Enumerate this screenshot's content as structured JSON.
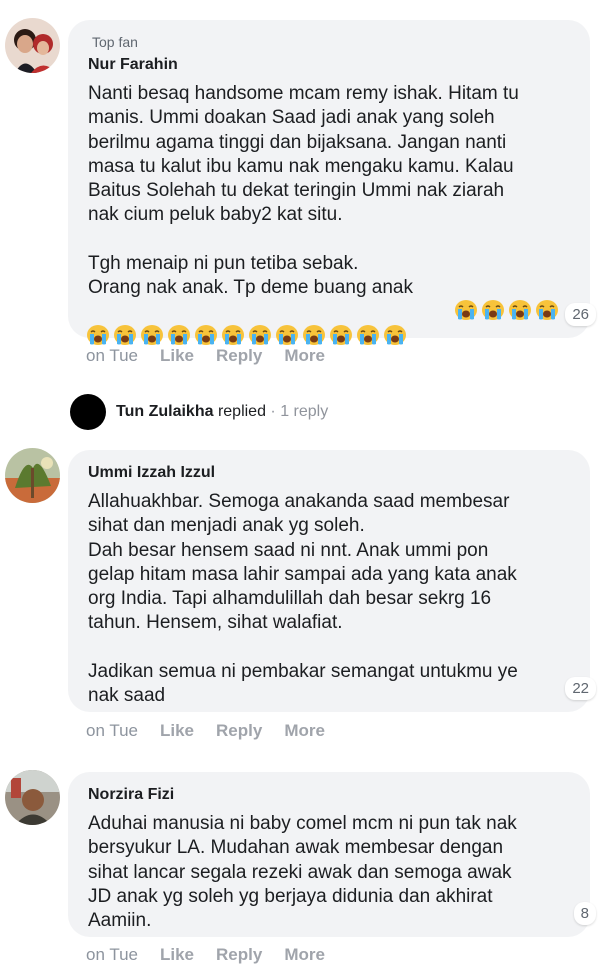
{
  "comments": [
    {
      "badge": "Top fan",
      "author": "Nur Farahin",
      "body": "Nanti besaq handsome mcam remy ishak. Hitam tu\nmanis. Ummi doakan Saad jadi anak yang soleh\nberilmu agama tinggi dan bijaksana. Jangan nanti\nmasa tu kalut ibu kamu nak mengaku kamu. Kalau\nBaitus Solehah tu dekat teringin Ummi nak ziarah\nnak cium peluk baby2 kat situ.\n\nTgh menaip ni pun tetiba sebak.\nOrang nak anak. Tp deme buang anak",
      "emoji_name": "loudly-crying-face-icon",
      "emoji_count_line1": 4,
      "emoji_count_line2": 12,
      "reaction_count": "26",
      "time": "on Tue",
      "like": "Like",
      "reply": "Reply",
      "more": "More"
    },
    {
      "author": "Ummi Izzah Izzul",
      "body": "Allahuakhbar. Semoga anakanda saad membesar\nsihat dan menjadi anak yg soleh.\nDah besar hensem saad ni nnt. Anak ummi pon\ngelap hitam masa lahir sampai ada yang kata anak\norg India. Tapi alhamdulillah dah besar sekrg 16\ntahun. Hensem, sihat walafiat.\n\nJadikan semua ni pembakar semangat untukmu ye\nnak saad",
      "reaction_count": "22",
      "time": "on Tue",
      "like": "Like",
      "reply": "Reply",
      "more": "More"
    },
    {
      "author": "Norzira Fizi",
      "body": "Aduhai manusia ni baby comel mcm ni pun tak nak\nbersyukur LA. Mudahan awak membesar dengan\nsihat lancar segala rezeki awak dan semoga awak\nJD anak yg soleh yg berjaya didunia dan akhirat\nAamiin.",
      "reaction_count": "8",
      "time": "on Tue",
      "like": "Like",
      "reply": "Reply",
      "more": "More"
    }
  ],
  "reply_thread": {
    "name": "Tun Zulaikha",
    "verb": "replied",
    "meta": "· 1 reply"
  }
}
